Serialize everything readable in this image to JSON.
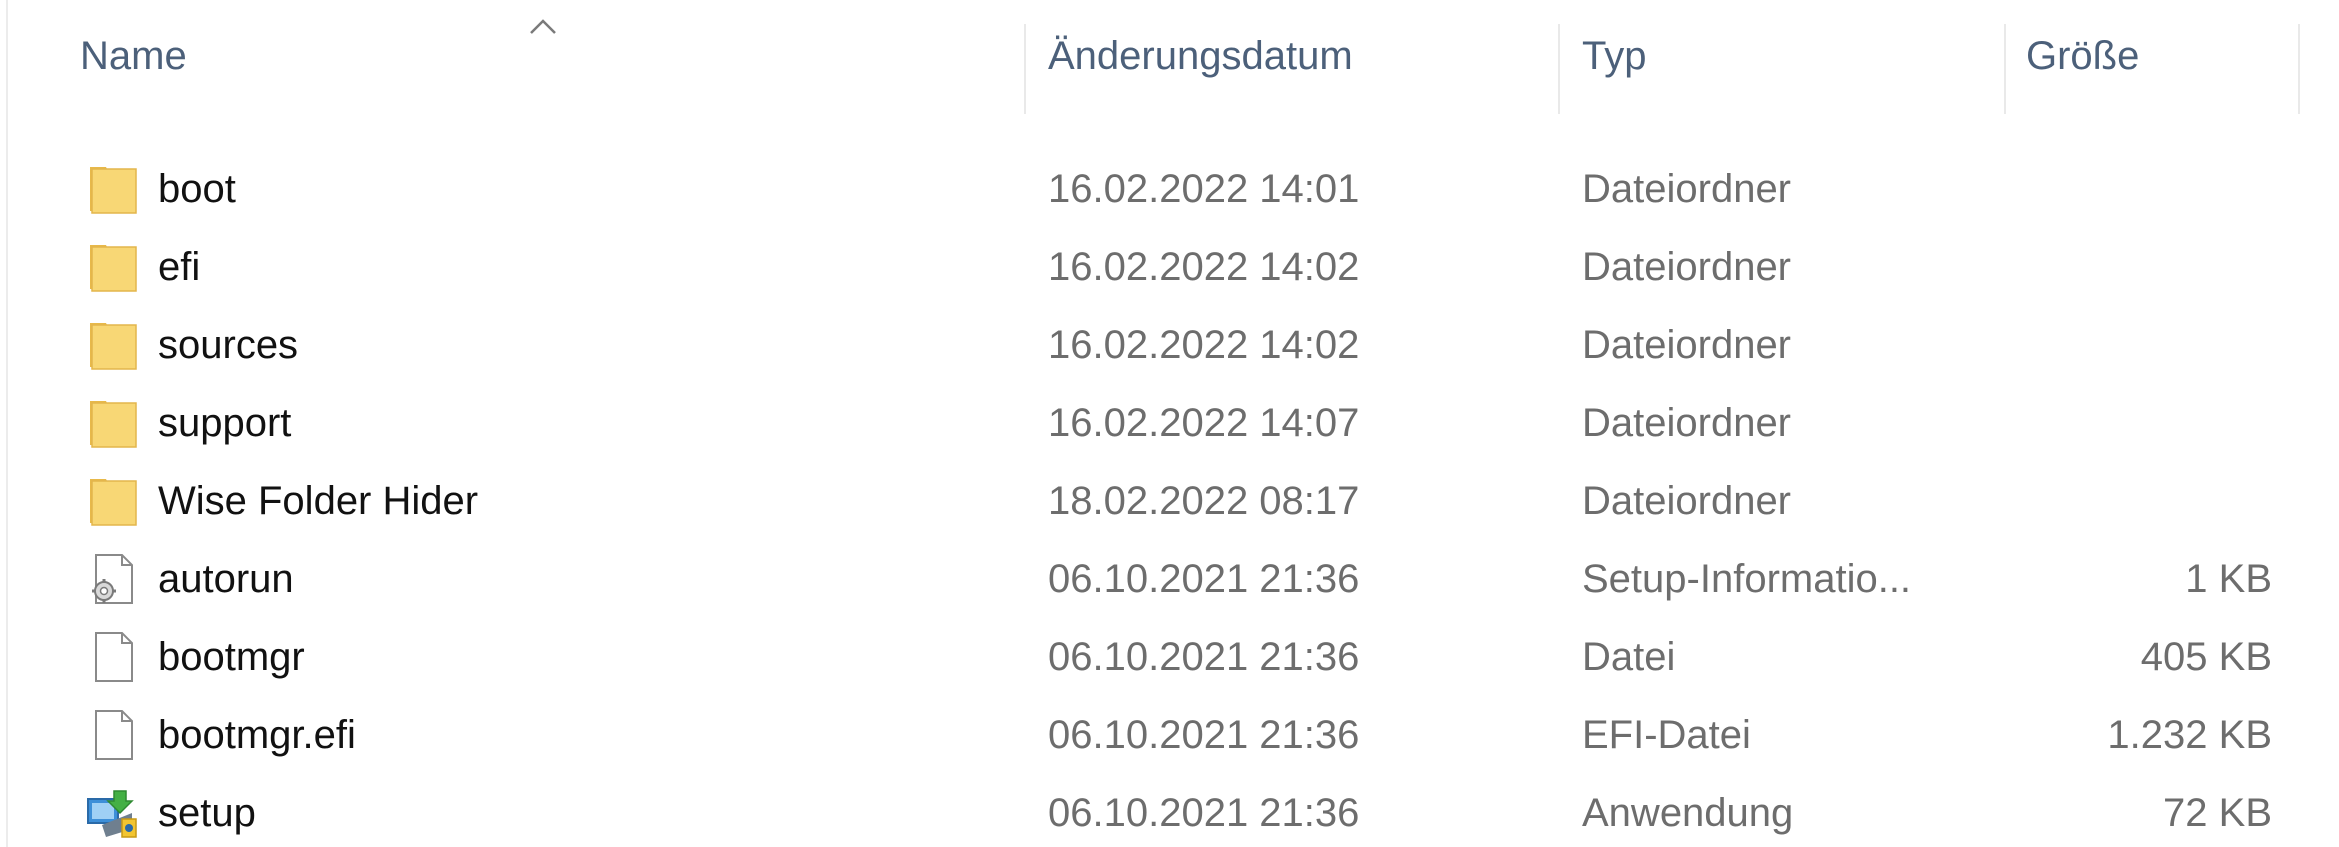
{
  "header": {
    "name": "Name",
    "date": "Änderungsdatum",
    "type": "Typ",
    "size": "Größe",
    "sort_icon": "chevron-up-icon"
  },
  "files": [
    {
      "name": "boot",
      "date": "16.02.2022 14:01",
      "type": "Dateiordner",
      "size": "",
      "icon": "folder-icon"
    },
    {
      "name": "efi",
      "date": "16.02.2022 14:02",
      "type": "Dateiordner",
      "size": "",
      "icon": "folder-icon"
    },
    {
      "name": "sources",
      "date": "16.02.2022 14:02",
      "type": "Dateiordner",
      "size": "",
      "icon": "folder-icon"
    },
    {
      "name": "support",
      "date": "16.02.2022 14:07",
      "type": "Dateiordner",
      "size": "",
      "icon": "folder-icon"
    },
    {
      "name": "Wise Folder Hider",
      "date": "18.02.2022 08:17",
      "type": "Dateiordner",
      "size": "",
      "icon": "folder-icon"
    },
    {
      "name": "autorun",
      "date": "06.10.2021 21:36",
      "type": "Setup-Informatio...",
      "size": "1 KB",
      "icon": "setup-info-file-icon"
    },
    {
      "name": "bootmgr",
      "date": "06.10.2021 21:36",
      "type": "Datei",
      "size": "405 KB",
      "icon": "file-icon"
    },
    {
      "name": "bootmgr.efi",
      "date": "06.10.2021 21:36",
      "type": "EFI-Datei",
      "size": "1.232 KB",
      "icon": "file-icon"
    },
    {
      "name": "setup",
      "date": "06.10.2021 21:36",
      "type": "Anwendung",
      "size": "72 KB",
      "icon": "setup-application-icon"
    }
  ],
  "colors": {
    "header_text": "#4c607a",
    "name_text": "#111111",
    "detail_text": "#6d6d6d",
    "folder_yellow": "#f8d775"
  }
}
